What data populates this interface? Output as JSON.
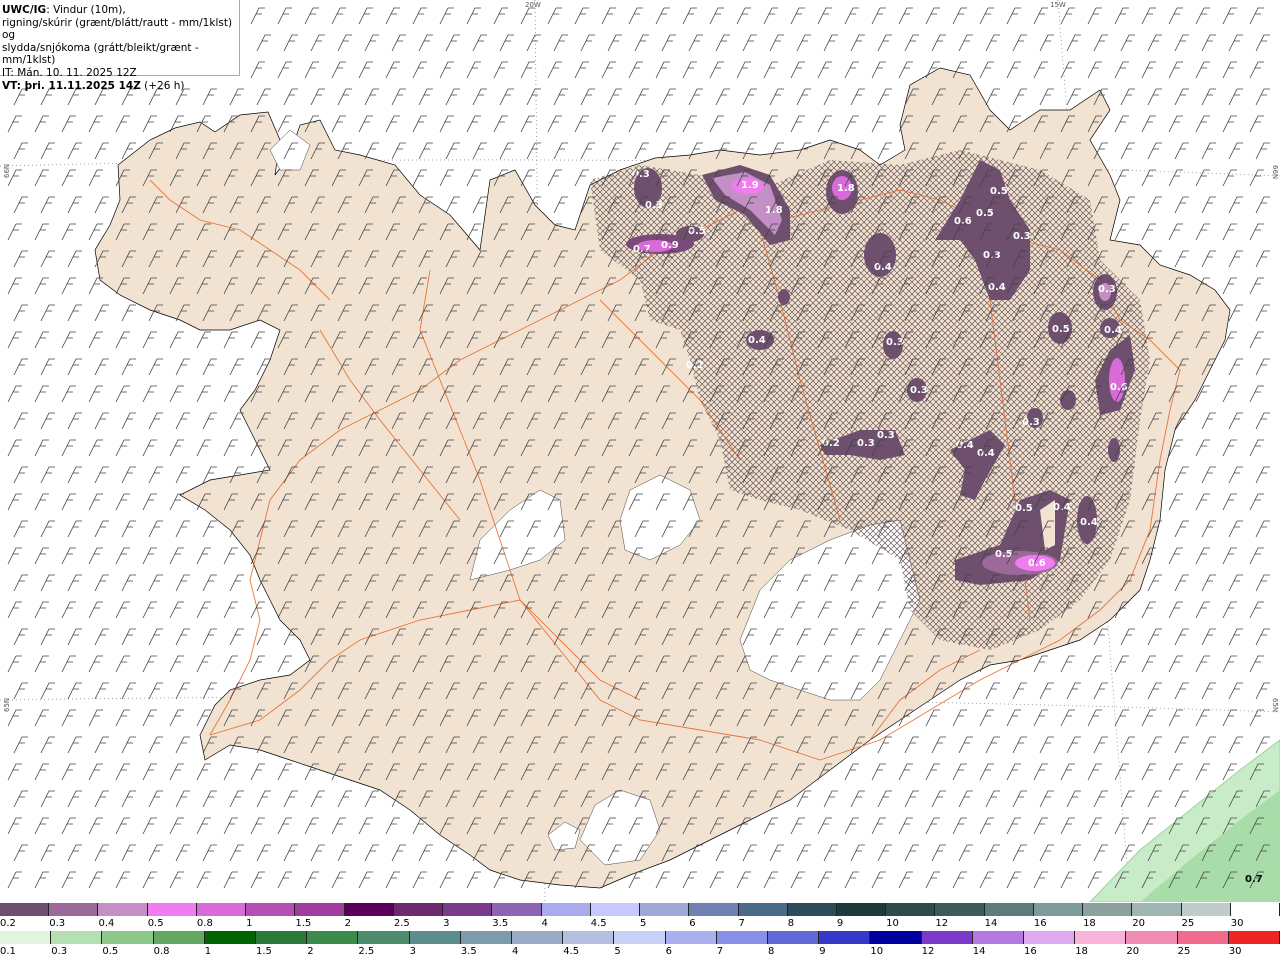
{
  "header": {
    "line1_bold": "UWC/IG",
    "line1_rest": ": Vindur (10m),",
    "line2": "rigning/skúrir (grænt/blátt/rautt - mm/1klst) og",
    "line3": "slydda/snjókoma (grátt/bleikt/grænt - mm/1klst)",
    "line4": "IT: Mán. 10. 11. 2025 12Z",
    "line5_bold": "VT: þri. 11.11.2025 14Z",
    "line5_rest": " (+26 h)"
  },
  "graticule_labels": {
    "top_20w": "20W",
    "top_15w": "15W",
    "left_66n": "66N",
    "left_65n": "65N",
    "right_66n": "66N",
    "right_65n": "65N"
  },
  "precip_values": [
    "0.3",
    "0.3",
    "0.7",
    "0.9",
    "0.5",
    "1.9",
    "1.8",
    "1.8",
    "0.5",
    "0.5",
    "0.6",
    "0.3",
    "0.4",
    "0.3",
    "0.4",
    "0.4",
    "0.3",
    "0.3",
    "0.3",
    "0.2",
    "0.5",
    "0.4",
    "0.6",
    "0.3",
    "0.2",
    "0.3",
    "0.3",
    "0.4",
    "0.4",
    "0.5",
    "0.5",
    "0.4",
    "0.6",
    "0.4",
    "0.7"
  ],
  "snow_scale": {
    "labels": [
      "0.2",
      "0.3",
      "0.4",
      "0.5",
      "0.8",
      "1",
      "1.5",
      "2",
      "2.5",
      "3",
      "3.5",
      "4",
      "4.5",
      "5",
      "6",
      "7",
      "8",
      "9",
      "10",
      "12",
      "14",
      "16",
      "18",
      "20",
      "25",
      "30"
    ],
    "colors": [
      "#6e4f6e",
      "#9b6a9b",
      "#c48fc4",
      "#f07cf0",
      "#d86bd8",
      "#b44fb4",
      "#a03ca0",
      "#5a005a",
      "#6e2a6e",
      "#7a3c8a",
      "#8c64b4",
      "#aaaaee",
      "#c8c8ff",
      "#a0a8d8",
      "#7080b0",
      "#4a6a8a",
      "#2c4c5c",
      "#1c3c3c",
      "#2c4c4c",
      "#3c5c5c",
      "#5c7c7c",
      "#7c9c9c",
      "#8ca0a0",
      "#a0b4b4",
      "#c0cccc",
      "#ffffff"
    ]
  },
  "rain_scale": {
    "labels": [
      "0.1",
      "0.3",
      "0.5",
      "0.8",
      "1",
      "1.5",
      "2",
      "2.5",
      "3",
      "3.5",
      "4",
      "4.5",
      "5",
      "6",
      "7",
      "8",
      "9",
      "10",
      "12",
      "14",
      "16",
      "18",
      "20",
      "25",
      "30"
    ],
    "colors": [
      "#e0f5e0",
      "#b4e0b4",
      "#8cc88c",
      "#64a864",
      "#006400",
      "#2a7a3a",
      "#3c8a4c",
      "#4c8c6c",
      "#5c8c8c",
      "#7c9cac",
      "#9cacc8",
      "#b4c0e0",
      "#c8d0f8",
      "#a8b0f0",
      "#8890e8",
      "#6068d8",
      "#3838c8",
      "#0000a0",
      "#7a3cc8",
      "#b478e0",
      "#e0a8f0",
      "#f8b4d8",
      "#f08cb4",
      "#f06c8c",
      "#f02424"
    ]
  }
}
